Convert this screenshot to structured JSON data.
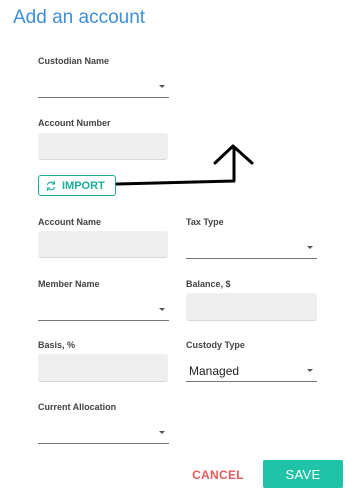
{
  "dialog": {
    "title": "Add an account"
  },
  "fields": {
    "custodian_name": {
      "label": "Custodian Name",
      "value": ""
    },
    "account_number": {
      "label": "Account Number",
      "value": ""
    },
    "account_name": {
      "label": "Account Name",
      "value": ""
    },
    "tax_type": {
      "label": "Tax Type",
      "value": ""
    },
    "member_name": {
      "label": "Member Name",
      "value": ""
    },
    "balance": {
      "label": "Balance, $",
      "value": ""
    },
    "basis": {
      "label": "Basis, %",
      "value": ""
    },
    "custody_type": {
      "label": "Custody Type",
      "value": "Managed"
    },
    "current_allocation": {
      "label": "Current Allocation",
      "value": ""
    }
  },
  "buttons": {
    "import": "IMPORT",
    "cancel": "CANCEL",
    "save": "SAVE"
  },
  "colors": {
    "title": "#3d8fd9",
    "accent": "#1aaf9b",
    "save_bg": "#20c2a8",
    "cancel": "#e35d5d"
  },
  "icons": {
    "import": "refresh-icon",
    "dropdown": "chevron-down-icon",
    "annotation": "hand-drawn-arrow"
  }
}
